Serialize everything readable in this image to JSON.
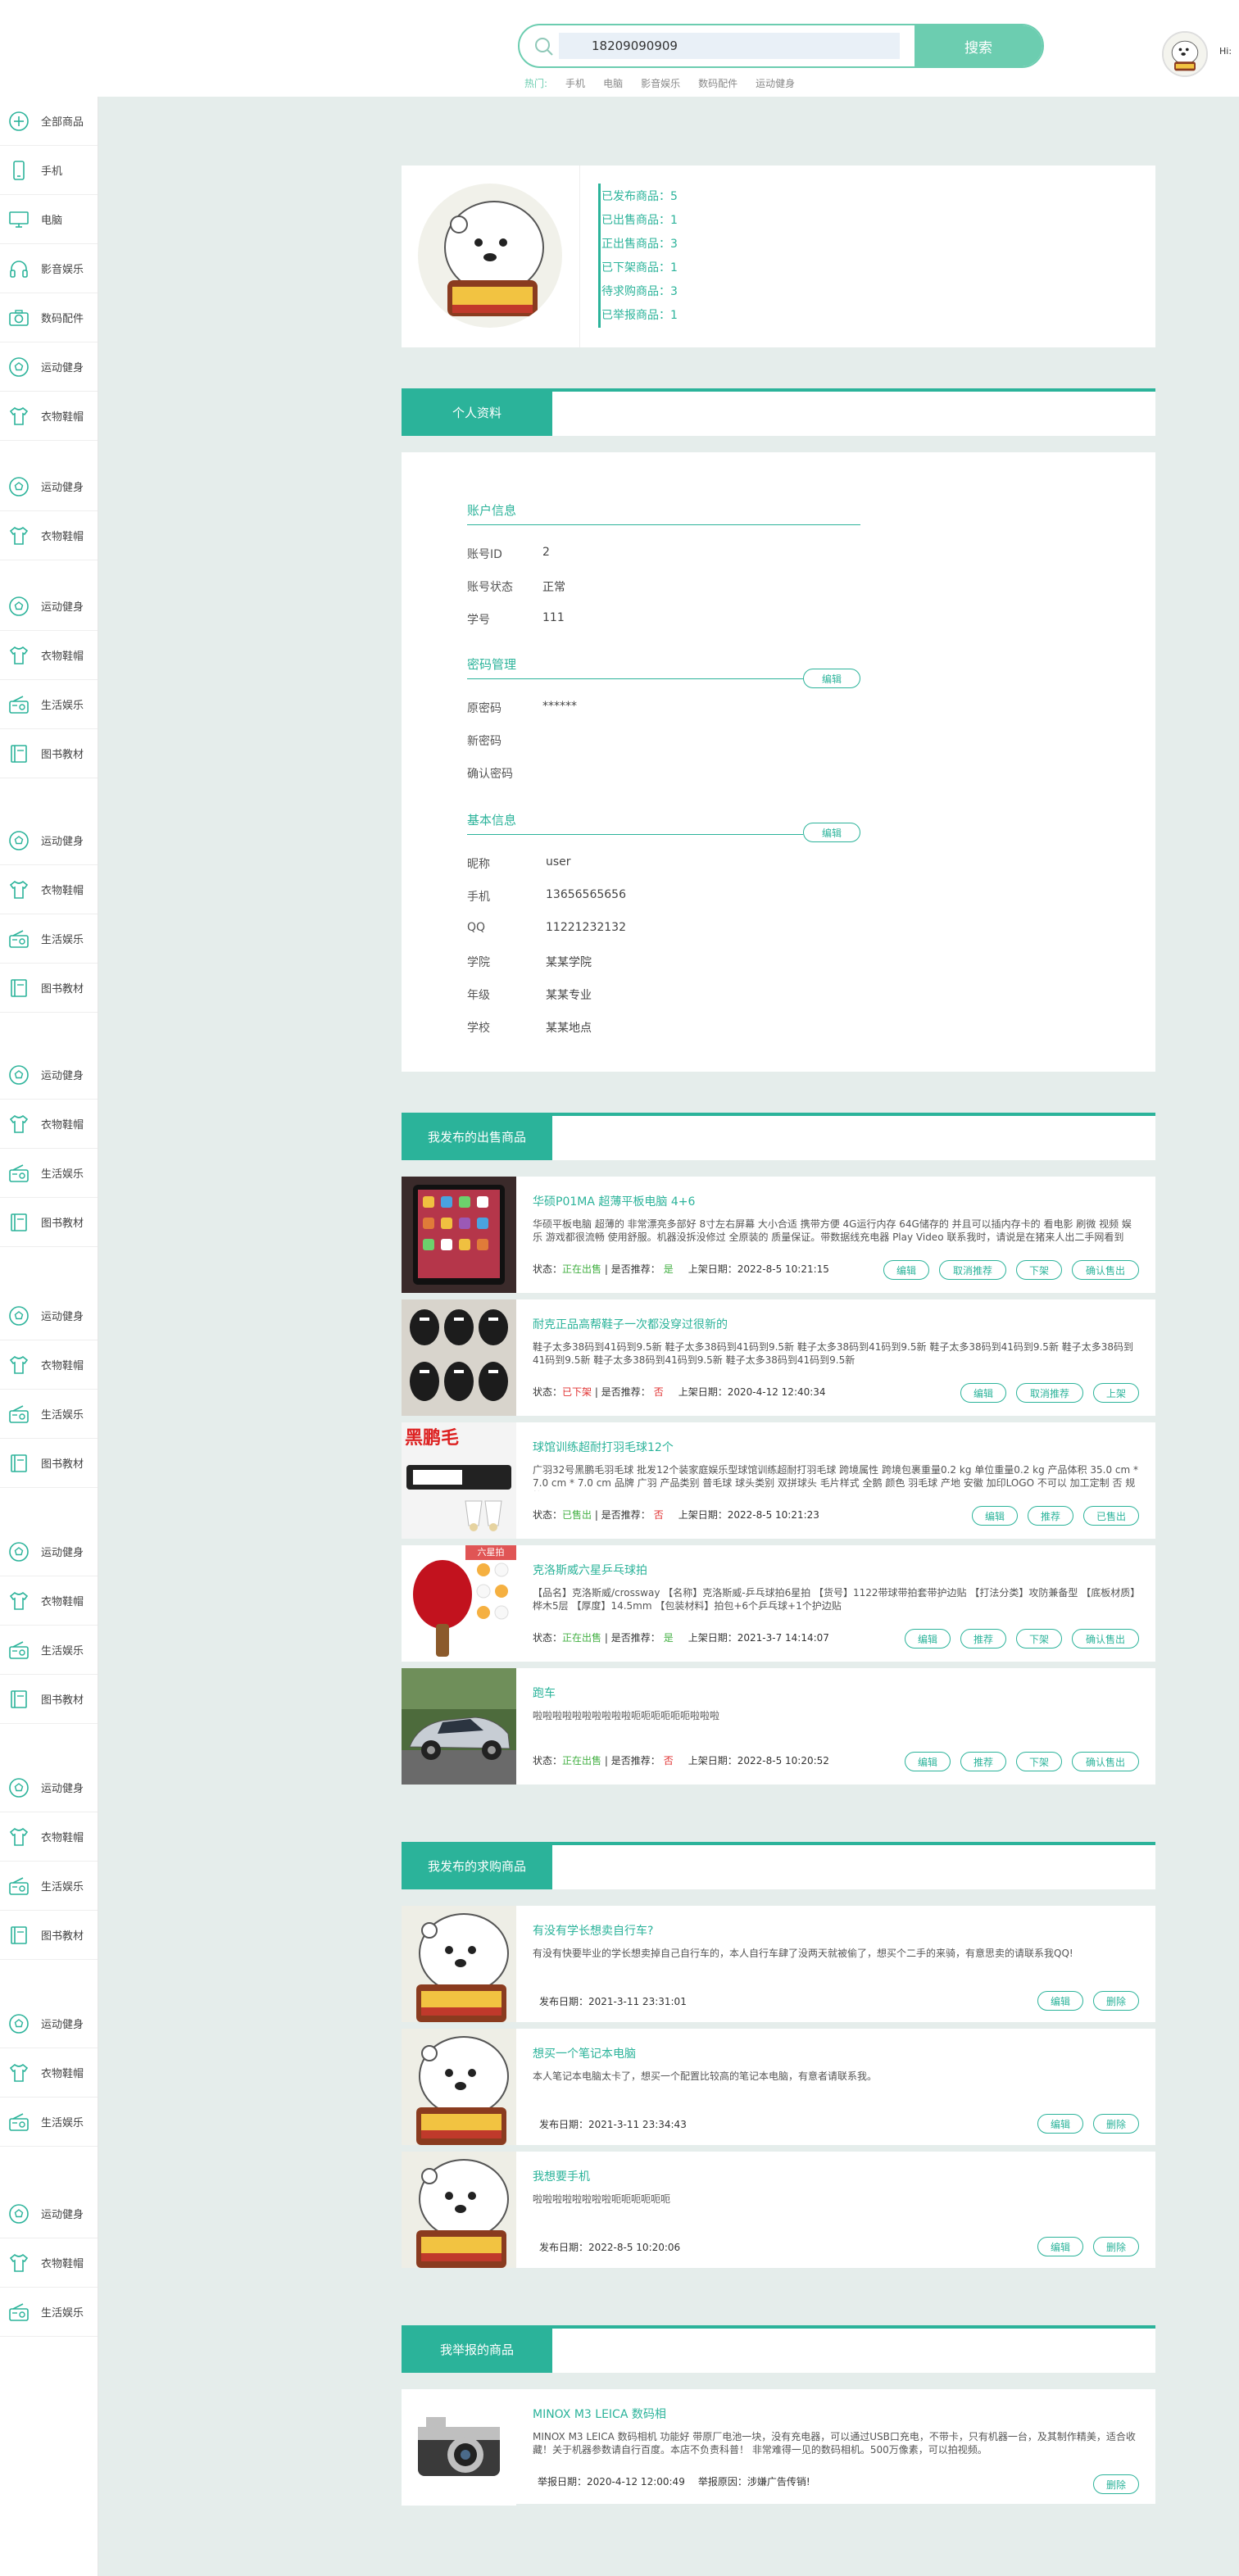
{
  "header": {
    "search_value": "18209090909",
    "search_button": "搜索",
    "hot_label": "热门:",
    "hot_links": [
      "手机",
      "电脑",
      "影音娱乐",
      "数码配件",
      "运动健身"
    ],
    "greeting": "Hi:"
  },
  "sidebar": {
    "items": [
      {
        "label": "全部商品",
        "icon": "plus-circle-icon"
      },
      {
        "label": "手机",
        "icon": "phone-icon"
      },
      {
        "label": "电脑",
        "icon": "monitor-icon"
      },
      {
        "label": "影音娱乐",
        "icon": "headphone-icon"
      },
      {
        "label": "数码配件",
        "icon": "camera-icon"
      },
      {
        "label": "运动健身",
        "icon": "ball-icon"
      },
      {
        "label": "衣物鞋帽",
        "icon": "shirt-icon"
      },
      {
        "label": "运动健身",
        "icon": "ball-icon"
      },
      {
        "label": "衣物鞋帽",
        "icon": "shirt-icon"
      },
      {
        "label": "运动健身",
        "icon": "ball-icon"
      },
      {
        "label": "衣物鞋帽",
        "icon": "shirt-icon"
      },
      {
        "label": "生活娱乐",
        "icon": "radio-icon"
      },
      {
        "label": "图书教材",
        "icon": "book-icon"
      },
      {
        "label": "运动健身",
        "icon": "ball-icon"
      },
      {
        "label": "衣物鞋帽",
        "icon": "shirt-icon"
      },
      {
        "label": "生活娱乐",
        "icon": "radio-icon"
      },
      {
        "label": "图书教材",
        "icon": "book-icon"
      },
      {
        "label": "运动健身",
        "icon": "ball-icon"
      },
      {
        "label": "衣物鞋帽",
        "icon": "shirt-icon"
      },
      {
        "label": "生活娱乐",
        "icon": "radio-icon"
      },
      {
        "label": "图书教材",
        "icon": "book-icon"
      },
      {
        "label": "运动健身",
        "icon": "ball-icon"
      },
      {
        "label": "衣物鞋帽",
        "icon": "shirt-icon"
      },
      {
        "label": "生活娱乐",
        "icon": "radio-icon"
      },
      {
        "label": "图书教材",
        "icon": "book-icon"
      },
      {
        "label": "运动健身",
        "icon": "ball-icon"
      },
      {
        "label": "衣物鞋帽",
        "icon": "shirt-icon"
      },
      {
        "label": "生活娱乐",
        "icon": "radio-icon"
      },
      {
        "label": "图书教材",
        "icon": "book-icon"
      },
      {
        "label": "运动健身",
        "icon": "ball-icon"
      },
      {
        "label": "衣物鞋帽",
        "icon": "shirt-icon"
      },
      {
        "label": "生活娱乐",
        "icon": "radio-icon"
      },
      {
        "label": "图书教材",
        "icon": "book-icon"
      },
      {
        "label": "运动健身",
        "icon": "ball-icon"
      },
      {
        "label": "衣物鞋帽",
        "icon": "shirt-icon"
      },
      {
        "label": "生活娱乐",
        "icon": "radio-icon"
      },
      {
        "label": "运动健身",
        "icon": "ball-icon"
      },
      {
        "label": "衣物鞋帽",
        "icon": "shirt-icon"
      },
      {
        "label": "生活娱乐",
        "icon": "radio-icon"
      }
    ]
  },
  "profile": {
    "stats": [
      "已发布商品：5",
      "已出售商品：1",
      "正出售商品：3",
      "已下架商品：1",
      "待求购商品：3",
      "已举报商品：1"
    ]
  },
  "personal": {
    "tab_label": "个人资料",
    "account_title": "账户信息",
    "account": [
      {
        "label": "账号ID",
        "value": "2"
      },
      {
        "label": "账号状态",
        "value": "正常"
      },
      {
        "label": "学号",
        "value": "111"
      }
    ],
    "password_title": "密码管理",
    "password": [
      {
        "label": "原密码",
        "value": "******"
      },
      {
        "label": "新密码",
        "value": ""
      },
      {
        "label": "确认密码",
        "value": ""
      }
    ],
    "basic_title": "基本信息",
    "basic": [
      {
        "label": "昵称",
        "value": "user"
      },
      {
        "label": "手机",
        "value": "13656565656"
      },
      {
        "label": "QQ",
        "value": "11221232132"
      },
      {
        "label": "学院",
        "value": "某某学院"
      },
      {
        "label": "年级",
        "value": "某某专业"
      },
      {
        "label": "学校",
        "value": "某某地点"
      }
    ],
    "edit_label": "编辑"
  },
  "selling": {
    "tab_label": "我发布的出售商品",
    "status_prefix": "状态：",
    "rec_prefix": " | 是否推荐：",
    "date_prefix": "上架日期：",
    "items": [
      {
        "title": "华硕P01MA 超薄平板电脑 4+6",
        "desc": "华硕平板电脑 超薄的 非常漂亮多部好 8寸左右屏幕 大小合适 携带方便 4G运行内存 64G储存的 并且可以插内存卡的 看电影 刷微 视频 娱乐 游戏都很流畅 使用舒服。机器没拆没修过 全原装的 质量保证。带数据线充电器 Play Video 联系我时，请说是在猪来人出二手网看到",
        "status": "正在出售",
        "rec": "是",
        "date": "2022-8-5 10:21:15",
        "buttons": [
          "编辑",
          "取消推荐",
          "下架",
          "确认售出"
        ],
        "tag": ""
      },
      {
        "title": "耐克正品高帮鞋子一次都没穿过很新的",
        "desc": "鞋子太多38码到41码到9.5新 鞋子太多38码到41码到9.5新 鞋子太多38码到41码到9.5新 鞋子太多38码到41码到9.5新 鞋子太多38码到41码到9.5新 鞋子太多38码到41码到9.5新 鞋子太多38码到41码到9.5新",
        "status": "已下架",
        "rec": "否",
        "date": "2020-4-12 12:40:34",
        "buttons": [
          "编辑",
          "取消推荐",
          "上架"
        ],
        "tag": ""
      },
      {
        "title": "球馆训练超耐打羽毛球12个",
        "desc": "广羽32号黑鹏毛羽毛球 批发12个装家庭娱乐型球馆训练超耐打羽毛球 跨境属性 跨境包裹重量0.2 kg 单位重量0.2 kg 产品体积 35.0 cm * 7.0 cm * 7.0 cm 品牌 广羽 产品类别 普毛球 球头类别 双拼球头 毛片样式 全鹅 颜色 羽毛球 产地 安徽 加印LOGO 不可以 加工定制 否 规格 12",
        "status": "已售出",
        "rec": "否",
        "date": "2022-8-5 10:21:23",
        "buttons": [
          "编辑",
          "推荐",
          "已售出"
        ],
        "tag": ""
      },
      {
        "title": "克洛斯威六星乒乓球拍",
        "desc": "【品名】克洛斯威/crossway 【名称】克洛斯威-乒乓球拍6星拍 【货号】1122带球带拍套带护边贴 【打法分类】攻防兼备型 【底板材质】桦木5层 【厚度】14.5mm 【包装材料】拍包+6个乒乓球+1个护边贴",
        "status": "正在出售",
        "rec": "是",
        "date": "2021-3-7 14:14:07",
        "buttons": [
          "编辑",
          "推荐",
          "下架",
          "确认售出"
        ],
        "tag": "六星拍"
      },
      {
        "title": "跑车",
        "desc": "啦啦啦啦啦啦啦啦啦啦呃呃呃呃呃呃啦啦啦",
        "status": "正在出售",
        "rec": "否",
        "date": "2022-8-5 10:20:52",
        "buttons": [
          "编辑",
          "推荐",
          "下架",
          "确认售出"
        ],
        "tag": ""
      }
    ]
  },
  "wanted": {
    "tab_label": "我发布的求购商品",
    "date_prefix": "发布日期：",
    "items": [
      {
        "title": "有没有学长想卖自行车?",
        "desc": "有没有快要毕业的学长想卖掉自己自行车的，本人自行车肆了没两天就被偷了，想买个二手的来骑，有意思卖的请联系我QQ!",
        "date": "2021-3-11 23:31:01",
        "buttons": [
          "编辑",
          "删除"
        ]
      },
      {
        "title": "想买一个笔记本电脑",
        "desc": "本人笔记本电脑太卡了，想买一个配置比较高的笔记本电脑，有意者请联系我。",
        "date": "2021-3-11 23:34:43",
        "buttons": [
          "编辑",
          "删除"
        ]
      },
      {
        "title": "我想要手机",
        "desc": "啦啦啦啦啦啦啦啦呃呃呃呃呃呃",
        "date": "2022-8-5 10:20:06",
        "buttons": [
          "编辑",
          "删除"
        ]
      }
    ]
  },
  "reported": {
    "tab_label": "我举报的商品",
    "date_prefix": "举报日期：",
    "reason_prefix": "举报原因：",
    "items": [
      {
        "title": "MINOX M3 LEICA 数码相",
        "desc": "MINOX M3 LEICA 数码相机 功能好 带原厂电池一块，没有充电器，可以通过USB口充电，不带卡，只有机器一台，及其制作精美，适合收藏！关于机器参数请自行百度。本店不负责科普！ 非常难得一见的数码相机。500万像素，可以拍视频。",
        "date": "2020-4-12 12:00:49",
        "reason": "涉嫌广告传销!",
        "buttons": [
          "删除"
        ]
      }
    ]
  }
}
